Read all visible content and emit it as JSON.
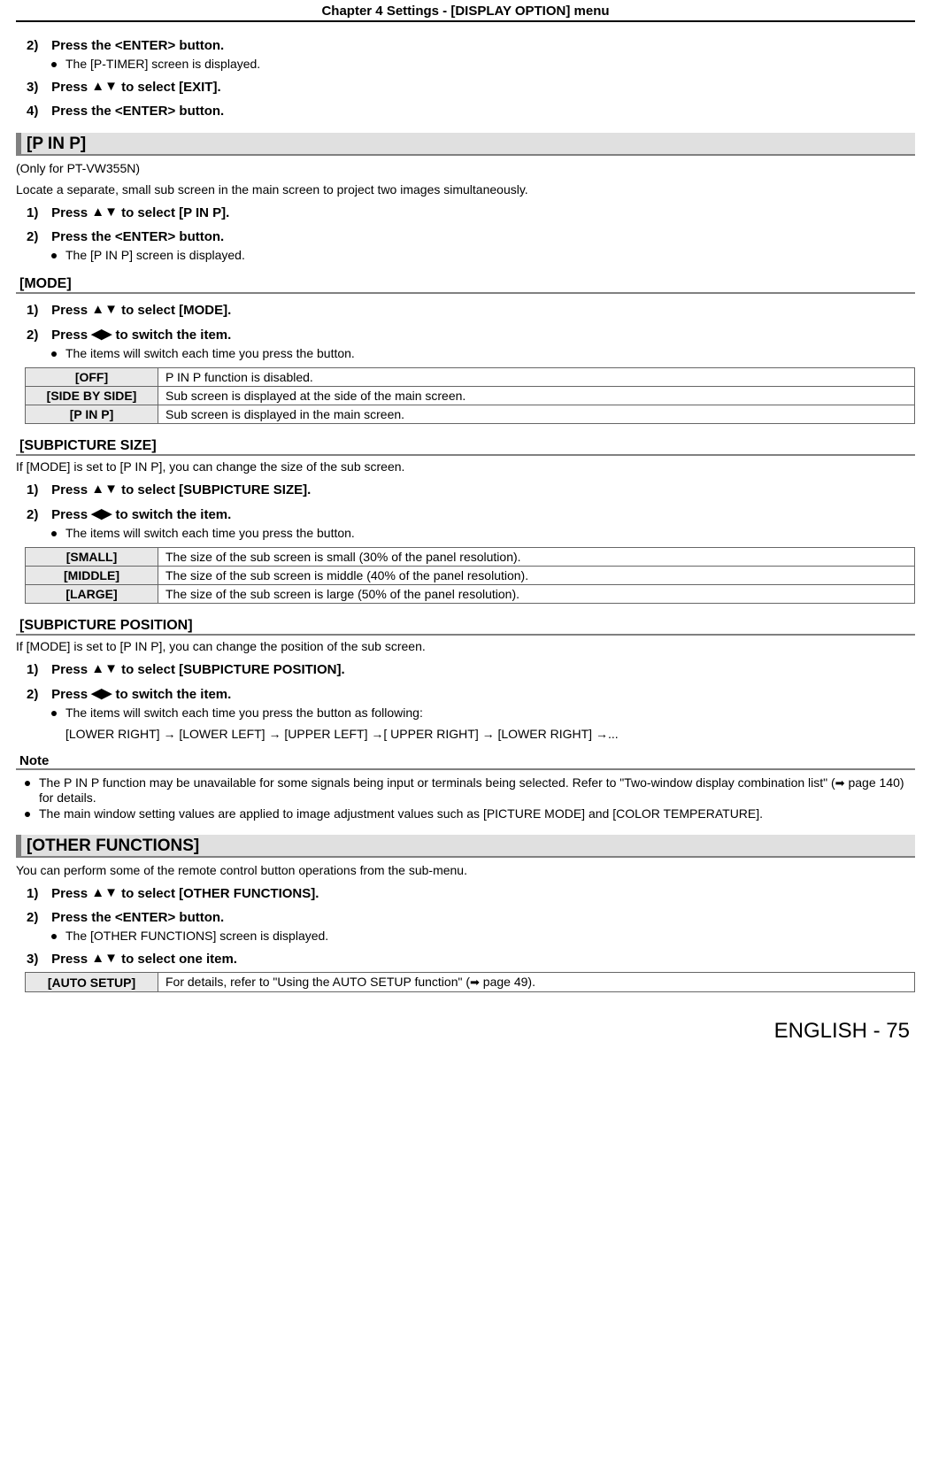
{
  "header": {
    "chapter": "Chapter 4   Settings - [DISPLAY OPTION] menu"
  },
  "arrows": {
    "updown": "▲▼",
    "leftright": "◀▶",
    "right": "➡"
  },
  "intro_steps": {
    "s2": {
      "num": "2)",
      "text": "Press the <ENTER> button."
    },
    "s2_sub": "The [P-TIMER] screen is displayed.",
    "s3": {
      "num": "3)",
      "prefix": "Press ",
      "suffix": " to select [EXIT]."
    },
    "s4": {
      "num": "4)",
      "text": "Press the <ENTER> button."
    }
  },
  "pinp": {
    "heading": "[P IN P]",
    "note": "(Only for PT-VW355N)",
    "desc": "Locate a separate, small sub screen in the main screen to project two images simultaneously.",
    "s1": {
      "num": "1)",
      "prefix": "Press ",
      "suffix": " to select [P IN P]."
    },
    "s2": {
      "num": "2)",
      "text": "Press the <ENTER> button."
    },
    "s2_sub": "The [P IN P] screen is displayed."
  },
  "mode": {
    "heading": "[MODE]",
    "s1": {
      "num": "1)",
      "prefix": "Press ",
      "suffix": " to select [MODE]."
    },
    "s2": {
      "num": "2)",
      "prefix": "Press ",
      "suffix": " to switch the item."
    },
    "s2_sub": "The items will switch each time you press the button.",
    "table": [
      {
        "key": "[OFF]",
        "val": "P IN P function is disabled."
      },
      {
        "key": "[SIDE BY SIDE]",
        "val": "Sub screen is displayed at the side of the main screen."
      },
      {
        "key": "[P IN P]",
        "val": "Sub screen is displayed in the main screen."
      }
    ]
  },
  "subsize": {
    "heading": "[SUBPICTURE SIZE]",
    "desc": "If [MODE] is set to [P IN P], you can change the size of the sub screen.",
    "s1": {
      "num": "1)",
      "prefix": "Press ",
      "suffix": " to select [SUBPICTURE SIZE]."
    },
    "s2": {
      "num": "2)",
      "prefix": "Press ",
      "suffix": " to switch the item."
    },
    "s2_sub": "The items will switch each time you press the button.",
    "table": [
      {
        "key": "[SMALL]",
        "val": "The size of the sub screen is small (30% of the panel resolution)."
      },
      {
        "key": "[MIDDLE]",
        "val": "The size of the sub screen is middle (40% of the panel resolution)."
      },
      {
        "key": "[LARGE]",
        "val": "The size of the sub screen is large (50% of the panel resolution)."
      }
    ]
  },
  "subpos": {
    "heading": "[SUBPICTURE POSITION]",
    "desc": "If [MODE] is set to [P IN P], you can change the position of the sub screen.",
    "s1": {
      "num": "1)",
      "prefix": "Press ",
      "suffix": " to select [SUBPICTURE POSITION]."
    },
    "s2": {
      "num": "2)",
      "prefix": "Press ",
      "suffix": " to switch the item."
    },
    "s2_sub": "The items will switch each time you press the button as following:",
    "s2_sub2": "[LOWER RIGHT] → [LOWER LEFT] → [UPPER LEFT] →[ UPPER RIGHT] → [LOWER RIGHT] →..."
  },
  "note_block": {
    "heading": "Note",
    "b1a": "The P IN P function may be unavailable for some signals being input or terminals being selected. Refer to \"Two-window display combination list\" (",
    "b1b": " page 140) for details.",
    "b2": "The main window setting values are applied to image adjustment values such as [PICTURE MODE] and [COLOR TEMPERATURE]."
  },
  "other": {
    "heading": "[OTHER FUNCTIONS]",
    "desc": "You can perform some of the remote control button operations from the sub-menu.",
    "s1": {
      "num": "1)",
      "prefix": "Press ",
      "suffix": " to select [OTHER FUNCTIONS]."
    },
    "s2": {
      "num": "2)",
      "text": "Press the <ENTER> button."
    },
    "s2_sub": "The [OTHER FUNCTIONS] screen is displayed.",
    "s3": {
      "num": "3)",
      "prefix": "Press ",
      "suffix": " to select one item."
    },
    "table": [
      {
        "key": "[AUTO SETUP]",
        "val_a": "For details, refer to \"Using the AUTO SETUP function\" (",
        "val_b": " page 49)."
      }
    ]
  },
  "footer": "ENGLISH - 75"
}
